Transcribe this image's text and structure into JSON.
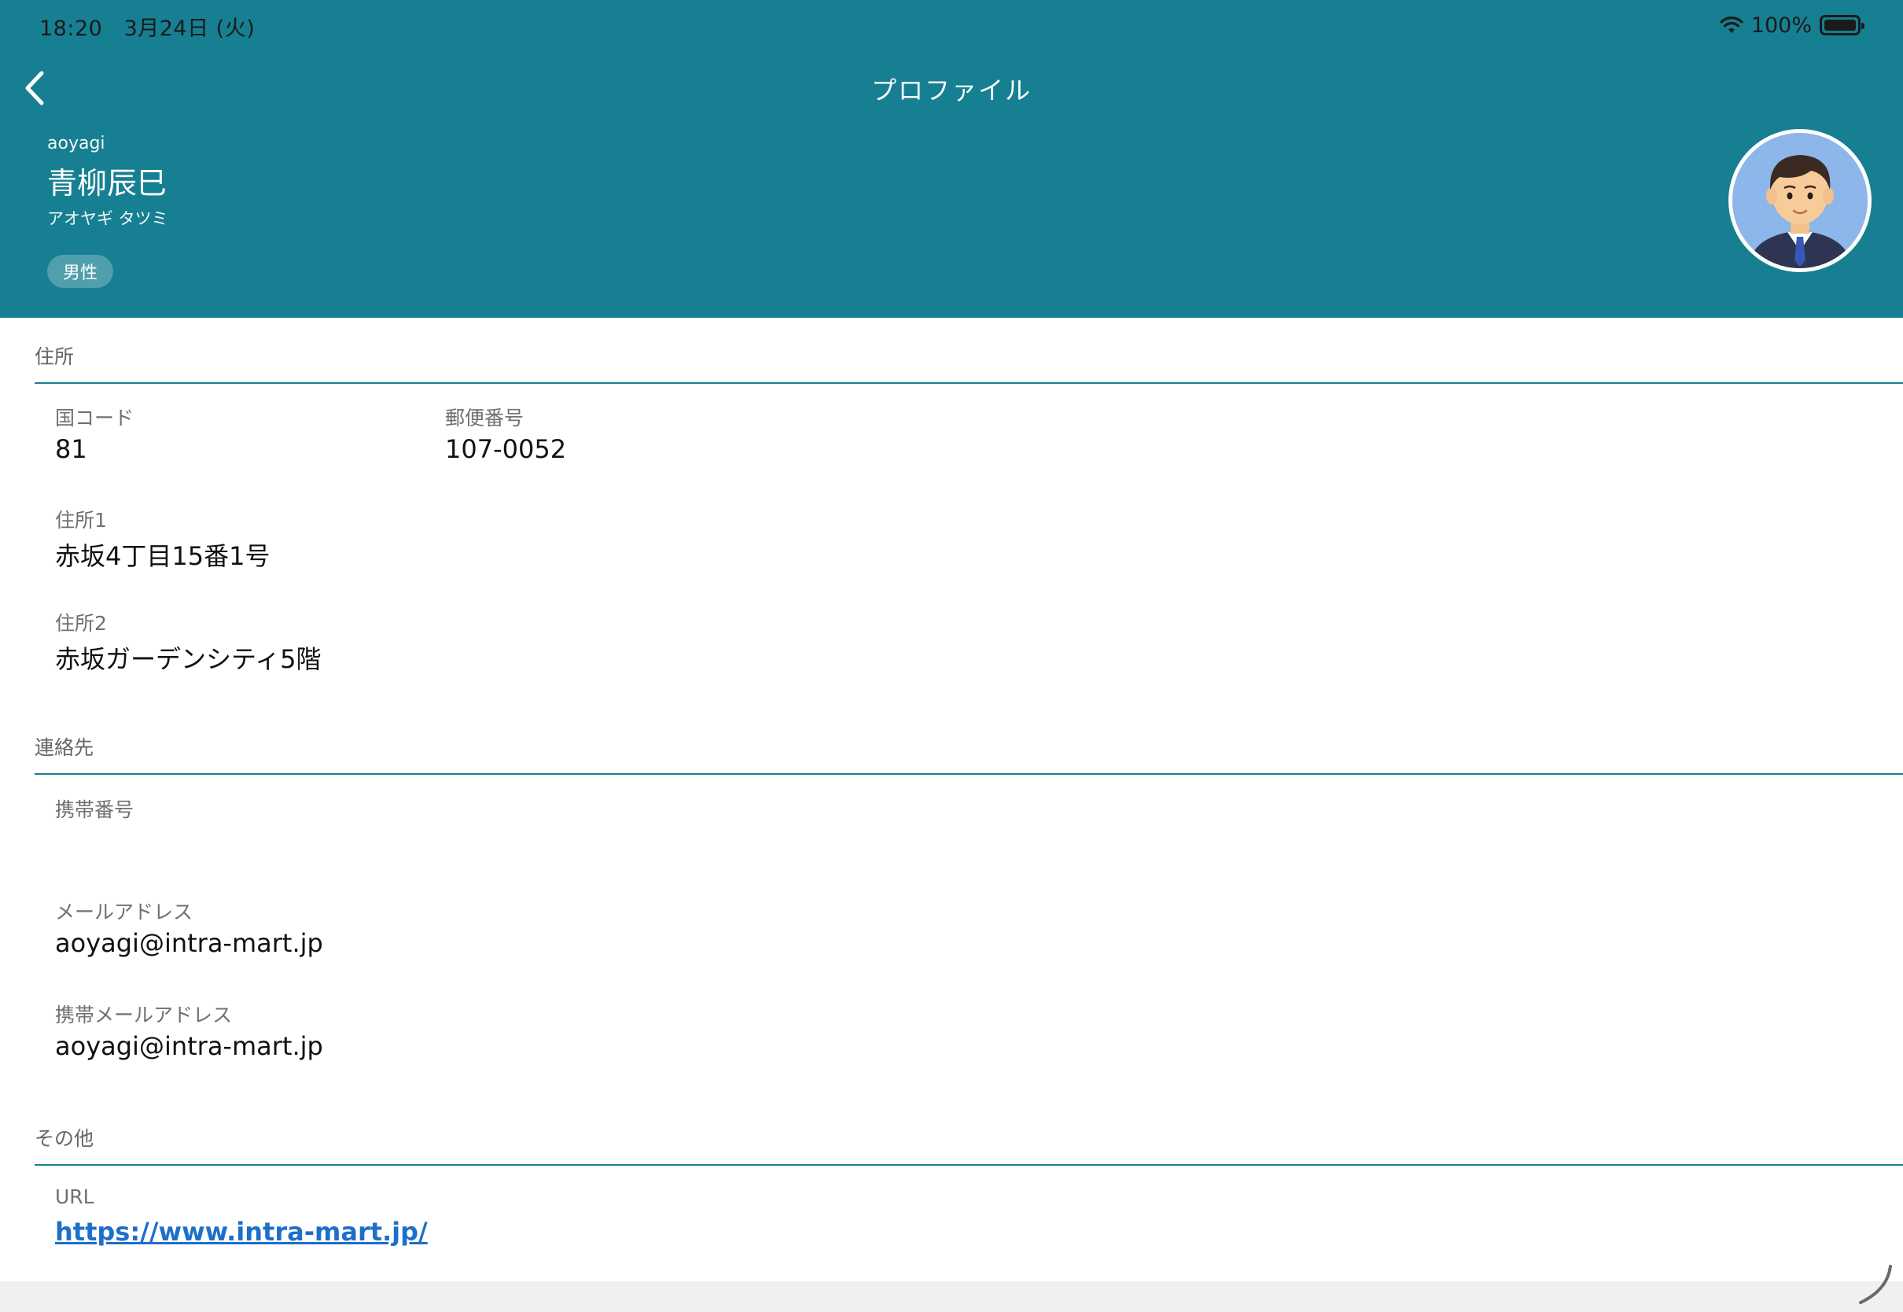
{
  "status_bar": {
    "time": "18:20",
    "date": "3月24日 (火)",
    "battery_text": "100%",
    "battery_level": 1.0
  },
  "nav": {
    "title": "プロファイル",
    "back_icon": "chevron-left-icon"
  },
  "profile": {
    "user_id": "aoyagi",
    "name": "青柳辰巳",
    "name_kana": "アオヤギ タツミ",
    "gender": "男性"
  },
  "sections": {
    "address": {
      "title": "住所",
      "country_code_label": "国コード",
      "country_code_value": "81",
      "postal_label": "郵便番号",
      "postal_value": "107-0052",
      "address1_label": "住所1",
      "address1_value": "赤坂4丁目15番1号",
      "address2_label": "住所2",
      "address2_value": "赤坂ガーデンシティ5階"
    },
    "contact": {
      "title": "連絡先",
      "mobile_label": "携帯番号",
      "mobile_value": "",
      "email_label": "メールアドレス",
      "email_value": "aoyagi@intra-mart.jp",
      "mobile_email_label": "携帯メールアドレス",
      "mobile_email_value": "aoyagi@intra-mart.jp"
    },
    "other": {
      "title": "その他",
      "url_label": "URL",
      "url_value": "https://www.intra-mart.jp/"
    }
  },
  "colors": {
    "header_bg": "#167f92",
    "divider": "#167f92",
    "link": "#1e6fc9"
  }
}
